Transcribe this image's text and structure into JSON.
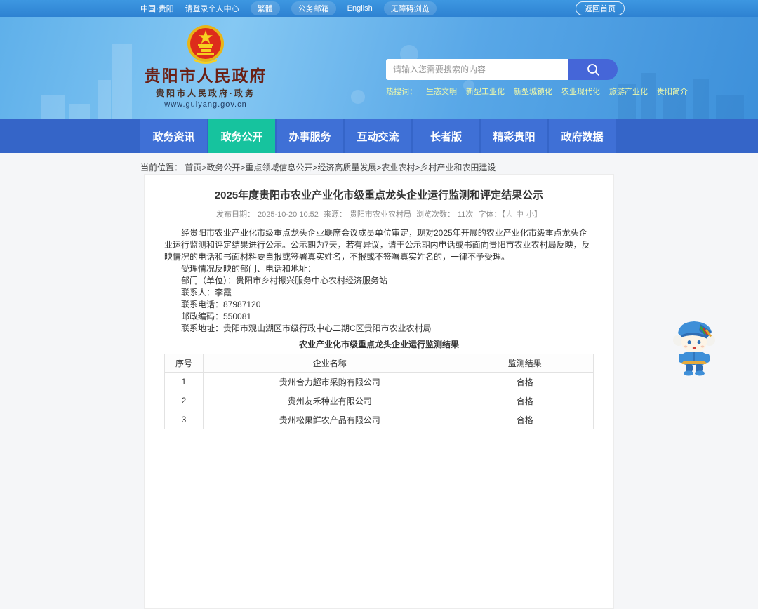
{
  "topbar": {
    "region": "中国·贵阳",
    "login": "请登录个人中心",
    "traditional": "繁體",
    "mailbox": "公务邮箱",
    "english": "English",
    "accessibility": "无障碍浏览",
    "home_button": "返回首页"
  },
  "header": {
    "site_title": "贵阳市人民政府",
    "site_subtitle": "贵阳市人民政府·政务",
    "site_url": "www.guiyang.gov.cn",
    "search": {
      "placeholder": "请输入您需要搜索的内容",
      "button_icon": "search-icon"
    },
    "hot_search": {
      "label": "热搜词：",
      "terms": [
        "生态文明",
        "新型工业化",
        "新型城镇化",
        "农业现代化",
        "旅游产业化",
        "贵阳简介"
      ]
    }
  },
  "nav": {
    "tabs": [
      {
        "label": "政务资讯",
        "active": false
      },
      {
        "label": "政务公开",
        "active": true
      },
      {
        "label": "办事服务",
        "active": false
      },
      {
        "label": "互动交流",
        "active": false
      },
      {
        "label": "长者版",
        "active": false
      },
      {
        "label": "精彩贵阳",
        "active": false
      },
      {
        "label": "政府数据",
        "active": false
      }
    ]
  },
  "breadcrumb": {
    "label": "当前位置：",
    "path": "首页>政务公开>重点领域信息公开>经济高质量发展>农业农村>乡村产业和农田建设"
  },
  "article": {
    "title": "2025年度贵阳市农业产业化市级重点龙头企业运行监测和评定结果公示",
    "meta": {
      "publish_label": "发布日期：",
      "publish_date": "2025-10-20 10:52",
      "source_label": "来源：",
      "source": "贵阳市农业农村局",
      "views_label": "浏览次数：",
      "views": "11次",
      "font_label": "字体：【",
      "font_close": "】",
      "font_sizes": [
        "大",
        "中",
        "小"
      ]
    },
    "paragraphs": [
      "经贵阳市农业产业化市级重点龙头企业联席会议成员单位审定，现对2025年开展的农业产业化市级重点龙头企业运行监测和评定结果进行公示。公示期为7天，若有异议，请于公示期内电话或书面向贵阳市农业农村局反映，反映情况的电话和书面材料要自报或签署真实姓名，不报或不签署真实姓名的，一律不予受理。",
      "受理情况反映的部门、电话和地址：",
      "部门（单位）：贵阳市乡村振兴服务中心农村经济服务站",
      "联系人：李霞",
      "联系电话：87987120",
      "邮政编码：550081",
      "联系地址：贵阳市观山湖区市级行政中心二期C区贵阳市农业农村局"
    ],
    "table": {
      "caption": "农业产业化市级重点龙头企业运行监测结果",
      "headers": [
        "序号",
        "企业名称",
        "监测结果"
      ],
      "rows": [
        [
          "1",
          "贵州合力超市采购有限公司",
          "合格"
        ],
        [
          "2",
          "贵州友禾种业有限公司",
          "合格"
        ],
        [
          "3",
          "贵州松果鲜农产品有限公司",
          "合格"
        ]
      ]
    }
  },
  "colors": {
    "topbar_blue": "#3d97e1",
    "banner_blue": "#58a7e7",
    "nav_blue": "#3f70d6",
    "nav_active_teal": "#16c39e",
    "search_button_indigo": "#4566d8",
    "logo_title_maroon": "#6b2015",
    "hot_search_yellow": "#edf8ab",
    "card_background": "#ffffff",
    "page_background": "#f5f6f8"
  }
}
